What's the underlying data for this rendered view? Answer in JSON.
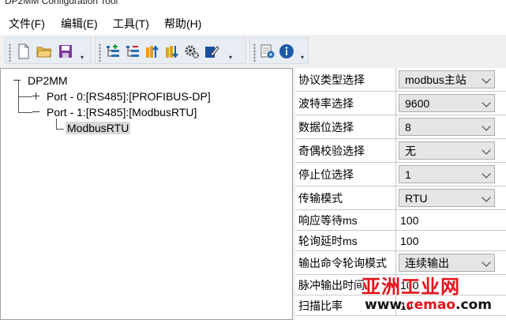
{
  "window": {
    "title": "DP2MM Configuration Tool"
  },
  "menu": [
    {
      "label": "文件(F)",
      "id": "file"
    },
    {
      "label": "编辑(E)",
      "id": "edit"
    },
    {
      "label": "工具(T)",
      "id": "tools"
    },
    {
      "label": "帮助(H)",
      "id": "help"
    }
  ],
  "toolbar": {
    "group1": [
      "new-file-icon",
      "open-folder-icon",
      "save-icon"
    ],
    "group2": [
      "add-node-icon",
      "remove-node-icon",
      "upload-icon",
      "download-icon",
      "settings-gear-icon",
      "edit-config-icon"
    ],
    "group3": [
      "export-report-icon",
      "info-icon"
    ]
  },
  "tree": {
    "root": "DP2MM",
    "ports": [
      {
        "label": "Port - 0:[RS485]:[PROFIBUS-DP]",
        "expanded": false
      },
      {
        "label": "Port - 1:[RS485]:[ModbusRTU]",
        "expanded": true,
        "children": [
          "ModbusRTU"
        ]
      }
    ]
  },
  "properties": [
    {
      "label": "协议类型选择",
      "value": "modbus主站",
      "type": "combo"
    },
    {
      "label": "波特率选择",
      "value": "9600",
      "type": "combo"
    },
    {
      "label": "数据位选择",
      "value": "8",
      "type": "combo"
    },
    {
      "label": "奇偶校验选择",
      "value": "无",
      "type": "combo"
    },
    {
      "label": "停止位选择",
      "value": "1",
      "type": "combo"
    },
    {
      "label": "传输模式",
      "value": "RTU",
      "type": "combo"
    },
    {
      "label": "响应等待ms",
      "value": "100",
      "type": "text"
    },
    {
      "label": "轮询延时ms",
      "value": "100",
      "type": "text"
    },
    {
      "label": "输出命令轮询模式",
      "value": "连续输出",
      "type": "combo"
    },
    {
      "label": "脉冲输出时间",
      "value": "100",
      "type": "text"
    },
    {
      "label": "扫描比率",
      "value": "10",
      "type": "text"
    }
  ],
  "watermark": {
    "main": "亚洲工业网",
    "url_prefix": "www.",
    "url_brand": "cemao",
    "url_suffix": ".com"
  }
}
